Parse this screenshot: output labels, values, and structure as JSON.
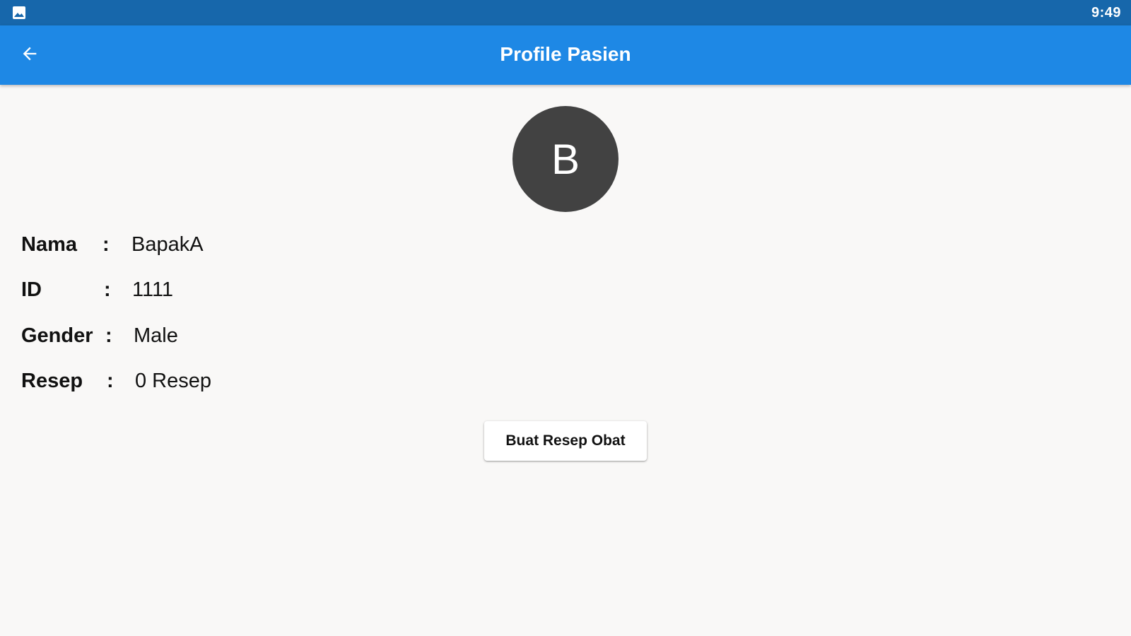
{
  "status_bar": {
    "time": "9:49",
    "notification_icon": "gallery-icon"
  },
  "app_bar": {
    "title": "Profile Pasien",
    "back_icon": "arrow-back-icon"
  },
  "avatar": {
    "initial": "B"
  },
  "profile": {
    "fields": [
      {
        "label": "Nama",
        "separator": ":",
        "value": "BapakA"
      },
      {
        "label": "ID",
        "separator": ":",
        "value": "1111"
      },
      {
        "label": "Gender",
        "separator": ":",
        "value": "Male"
      },
      {
        "label": "Resep",
        "separator": ":",
        "value": "0 Resep"
      }
    ]
  },
  "actions": {
    "create_prescription_label": "Buat Resep Obat"
  },
  "colors": {
    "status_bar": "#1767ab",
    "app_bar": "#1e88e5",
    "background": "#f9f8f7",
    "avatar": "#424242"
  }
}
